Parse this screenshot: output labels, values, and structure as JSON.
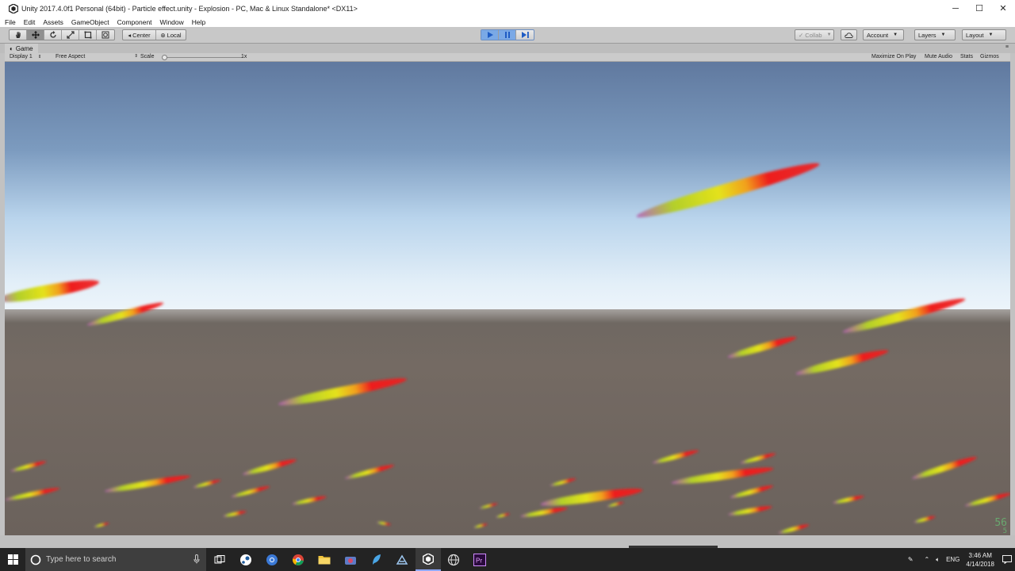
{
  "window": {
    "title": "Unity 2017.4.0f1 Personal (64bit) - Particle effect.unity - Explosion - PC, Mac & Linux Standalone* <DX11>",
    "buttons": {
      "minimize": "─",
      "maximize": "☐",
      "close": "✕"
    }
  },
  "menu": {
    "items": [
      "File",
      "Edit",
      "Assets",
      "GameObject",
      "Component",
      "Window",
      "Help"
    ]
  },
  "toolbar": {
    "tools": [
      "hand-tool",
      "move-tool",
      "rotate-tool",
      "scale-tool",
      "rect-tool",
      "transform-tool"
    ],
    "pivot_label": "Center",
    "space_label": "Local",
    "play_icon": "play-icon",
    "pause_icon": "pause-icon",
    "step_icon": "step-icon",
    "collab_label": "Collab",
    "account_label": "Account",
    "layers_label": "Layers",
    "layout_label": "Layout"
  },
  "tab": {
    "label": "Game"
  },
  "gamebar": {
    "display_label": "Display 1",
    "aspect_label": "Free Aspect",
    "scale_label": "Scale",
    "scale_value": "1x",
    "scale_fraction": 0,
    "maximize_label": "Maximize On Play",
    "mute_label": "Mute Audio",
    "stats_label": "Stats",
    "gizmos_label": "Gizmos"
  },
  "game": {
    "fps_top": "56",
    "fps_bottom": "5",
    "colors": {
      "sky_top": "#60799f",
      "sky_horizon": "#eef5fb",
      "ground": "#6b625c",
      "streak_red": "#ee1e1e",
      "streak_yellow": "#d6e21a",
      "streak_purple": "#b45fb4"
    }
  },
  "taskbar": {
    "search_placeholder": "Type here to search",
    "language": "ENG",
    "time": "3:46 AM",
    "date": "4/14/2018",
    "apps": [
      "task-view",
      "steam",
      "chrome-edge",
      "chrome",
      "file-explorer",
      "camera",
      "feather",
      "unity-hub",
      "unity",
      "globe",
      "premiere-pro"
    ]
  }
}
